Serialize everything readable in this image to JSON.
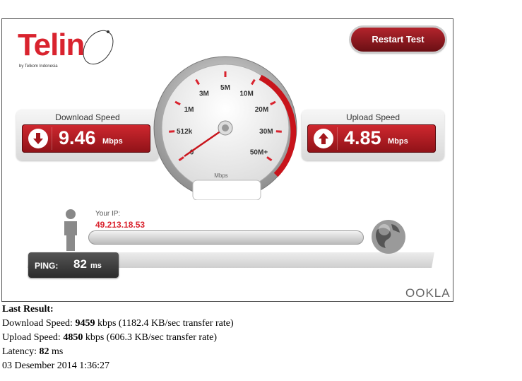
{
  "logo": {
    "text": "Telin",
    "subtext": "by Telkom Indonesia"
  },
  "restart_label": "Restart Test",
  "download": {
    "title": "Download Speed",
    "value": "9.46",
    "unit": "Mbps"
  },
  "upload": {
    "title": "Upload Speed",
    "value": "4.85",
    "unit": "Mbps"
  },
  "gauge": {
    "scale_labels": [
      "0",
      "512k",
      "1M",
      "3M",
      "5M",
      "10M",
      "20M",
      "30M",
      "50M+"
    ],
    "unit": "Mbps",
    "needle_value": "0",
    "accent": "#d9232e"
  },
  "ip": {
    "label": "Your IP:",
    "value": "49.213.18.53"
  },
  "ping": {
    "label": "PING:",
    "value": "82",
    "unit": "ms"
  },
  "brand": "OOKLA",
  "results": {
    "heading": "Last Result:",
    "download_prefix": "Download Speed: ",
    "download_value": "9459",
    "download_suffix": " kbps (1182.4 KB/sec transfer rate)",
    "upload_prefix": "Upload Speed: ",
    "upload_value": "4850",
    "upload_suffix": " kbps (606.3 KB/sec transfer rate)",
    "latency_prefix": "Latency: ",
    "latency_value": "82",
    "latency_suffix": " ms",
    "timestamp": "03 Desember 2014 1:36:27"
  }
}
